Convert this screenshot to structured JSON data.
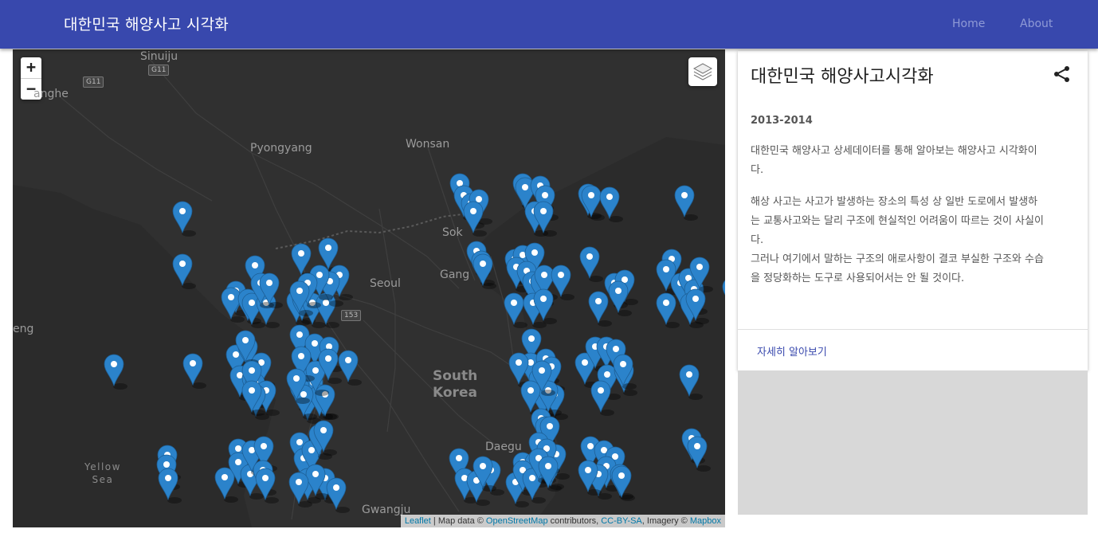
{
  "header": {
    "brand": "대한민국 해양사고 시각화",
    "nav": [
      "Home",
      "About"
    ],
    "colors": {
      "primary": "#3848ad",
      "nav_text": "#8f9ad6"
    }
  },
  "map": {
    "zoom_in": "+",
    "zoom_out": "−",
    "layers_icon": "layers-icon",
    "marker_color": "#2b83cb",
    "labels": {
      "sinuiju": "Sinuiju",
      "g11": "G11",
      "anghe": "anghe",
      "pyongyang": "Pyongyang",
      "wonsan": "Wonsan",
      "sokcho": "Sok",
      "gangneung": "Gang",
      "seoul": "Seoul",
      "r153": "153",
      "eng": "eng",
      "south": "South",
      "korea": "Korea",
      "daegu": "Daegu",
      "yellow": "Yellow",
      "sea": "Sea",
      "gwangju": "Gwangju"
    },
    "attribution": {
      "leaflet": "Leaflet",
      "sep1": " | Map data © ",
      "osm": "OpenStreetMap",
      "sep2": " contributors, ",
      "license": "CC-BY-SA",
      "sep3": ", Imagery © ",
      "mapbox": "Mapbox"
    }
  },
  "card": {
    "title": "대한민국 해양사고시각화",
    "share_icon": "share-icon",
    "years": "2013-2014",
    "paragraph1": "대한민국 해양사고 상세데이터를 통해 알아보는 해양사고 시각화이다.",
    "paragraph2": "해상 사고는 사고가 발생하는 장소의 특성 상 일반 도로에서 발생하는 교통사고와는 달리 구조에 현실적인 어려움이 따르는 것이 사실이다.",
    "paragraph3": "그러나 여기에서 말하는 구조의 애로사항이 결코 부실한 구조와 수습을 정당화하는 도구로 사용되어서는 안 될 것이다.",
    "action": "자세히 알아보기"
  }
}
